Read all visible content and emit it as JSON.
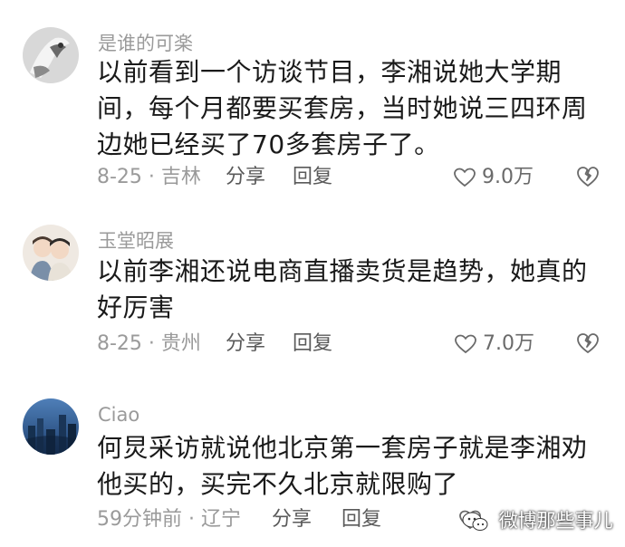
{
  "comments": [
    {
      "username": "是谁的可楽",
      "content": "以前看到一个访谈节目，李湘说她大学期间，每个月都要买套房，当时她说三四环周边她已经买了70多套房子了。",
      "time_location": "8-25 · 吉林",
      "share_label": "分享",
      "reply_label": "回复",
      "likes": "9.0万"
    },
    {
      "username": "玉堂昭展",
      "content": "以前李湘还说电商直播卖货是趋势，她真的好厉害",
      "time_location": "8-25 · 贵州",
      "share_label": "分享",
      "reply_label": "回复",
      "likes": "7.0万"
    },
    {
      "username": "Ciao",
      "content": "何炅采访就说他北京第一套房子就是李湘劝他买的，买完不久北京就限购了",
      "time_location": "59分钟前 · 辽宁",
      "share_label": "分享",
      "reply_label": "回复",
      "likes": ""
    }
  ],
  "watermark": {
    "text": "微博那些事儿"
  },
  "colors": {
    "text": "#1a1a1a",
    "muted": "#9a9a9a",
    "action": "#5a5a5a"
  },
  "icons": {
    "like": "heart-outline-icon",
    "dislike": "broken-heart-icon",
    "watermark_logo": "wechat-official-account-icon"
  }
}
